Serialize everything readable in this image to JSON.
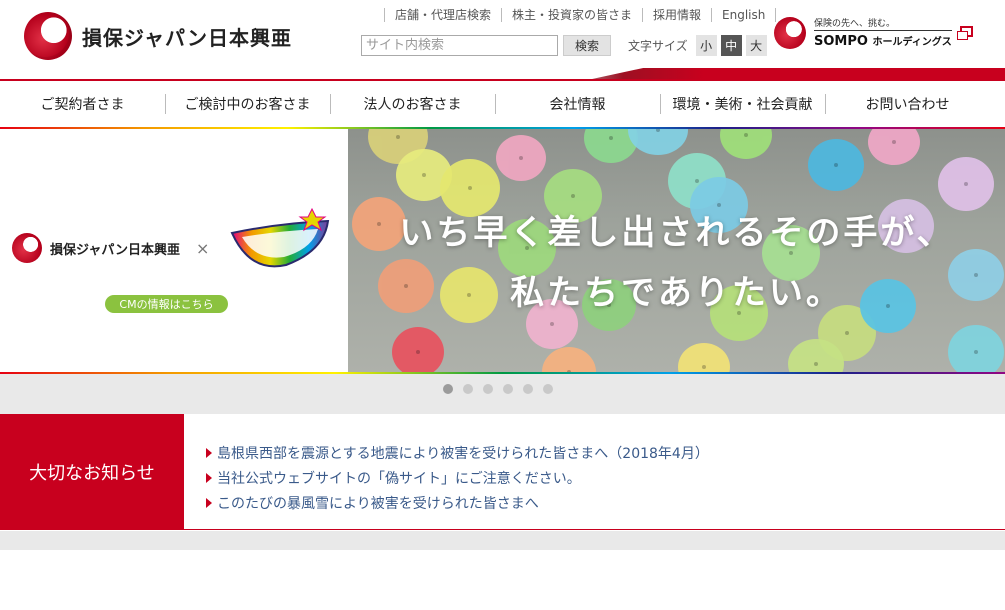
{
  "header": {
    "logo_text": "損保ジャパン日本興亜",
    "util_links": [
      "店舗・代理店検索",
      "株主・投資家の皆さま",
      "採用情報",
      "English"
    ],
    "search": {
      "placeholder": "サイト内検索",
      "button": "検索"
    },
    "fontsize": {
      "label": "文字サイズ",
      "small": "小",
      "medium": "中",
      "large": "大",
      "active": "medium"
    },
    "holdings": {
      "tagline": "保険の先へ、挑む。",
      "name": "SOMPO",
      "name_suffix": "ホールディングス"
    }
  },
  "nav": [
    "ご契約者さま",
    "ご検討中のお客さま",
    "法人のお客さま",
    "会社情報",
    "環境・美術・社会貢献",
    "お問い合わせ"
  ],
  "hero": {
    "cm_logo": "損保ジャパン日本興亜",
    "cross": "×",
    "cm_button": "CMの情報はこちら",
    "copy_line1": "いち早く差し出されるその手が、",
    "copy_line2": "私たちでありたい。",
    "slides": 6,
    "active_slide": 1
  },
  "notice": {
    "title": "大切なお知らせ",
    "items": [
      "島根県西部を震源とする地震により被害を受けられた皆さまへ（2018年4月）",
      "当社公式ウェブサイトの「偽サイト」にご注意ください。",
      "このたびの暴風雪により被害を受けられた皆さまへ"
    ]
  },
  "colors": {
    "brand_red": "#c8001e",
    "link": "#3a5a8a",
    "cm_green": "#8bc23f"
  }
}
